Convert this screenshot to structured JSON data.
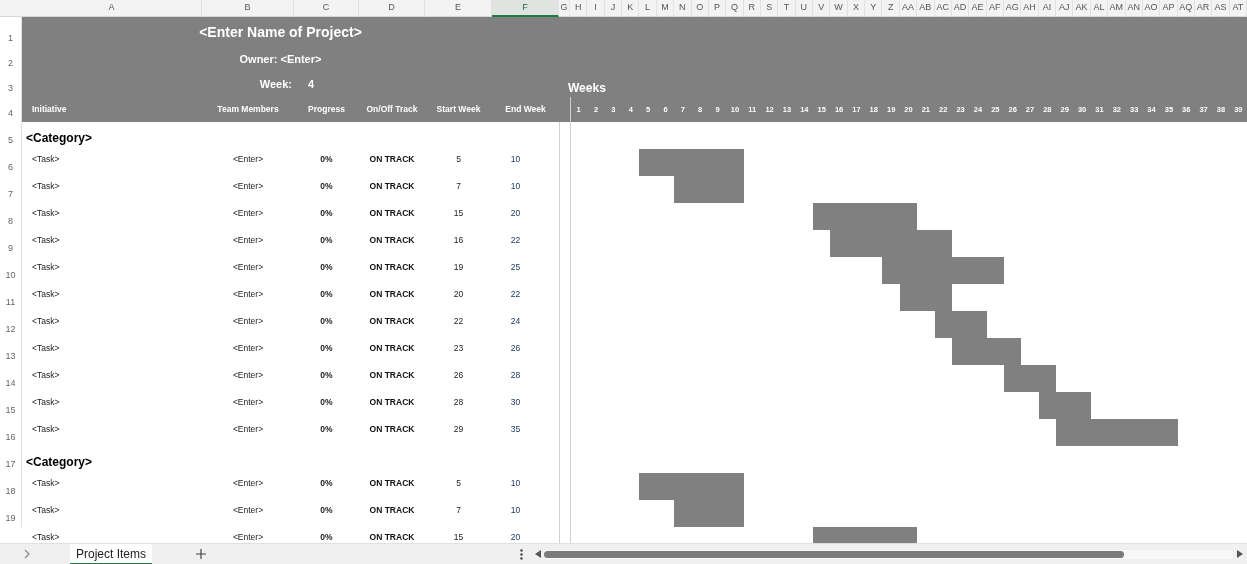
{
  "column_headers": [
    {
      "label": "A",
      "selected": false
    },
    {
      "label": "B",
      "selected": false
    },
    {
      "label": "C",
      "selected": false
    },
    {
      "label": "D",
      "selected": false
    },
    {
      "label": "E",
      "selected": false
    },
    {
      "label": "F",
      "selected": true
    },
    {
      "label": "G",
      "selected": false
    },
    {
      "label": "H",
      "selected": false
    },
    {
      "label": "I",
      "selected": false
    },
    {
      "label": "J",
      "selected": false
    },
    {
      "label": "K",
      "selected": false
    },
    {
      "label": "L",
      "selected": false
    },
    {
      "label": "M",
      "selected": false
    },
    {
      "label": "N",
      "selected": false
    },
    {
      "label": "O",
      "selected": false
    },
    {
      "label": "P",
      "selected": false
    },
    {
      "label": "Q",
      "selected": false
    },
    {
      "label": "R",
      "selected": false
    },
    {
      "label": "S",
      "selected": false
    },
    {
      "label": "T",
      "selected": false
    },
    {
      "label": "U",
      "selected": false
    },
    {
      "label": "V",
      "selected": false
    },
    {
      "label": "W",
      "selected": false
    },
    {
      "label": "X",
      "selected": false
    },
    {
      "label": "Y",
      "selected": false
    },
    {
      "label": "Z",
      "selected": false
    },
    {
      "label": "AA",
      "selected": false
    },
    {
      "label": "AB",
      "selected": false
    },
    {
      "label": "AC",
      "selected": false
    },
    {
      "label": "AD",
      "selected": false
    },
    {
      "label": "AE",
      "selected": false
    },
    {
      "label": "AF",
      "selected": false
    },
    {
      "label": "AG",
      "selected": false
    },
    {
      "label": "AH",
      "selected": false
    },
    {
      "label": "AI",
      "selected": false
    },
    {
      "label": "AJ",
      "selected": false
    },
    {
      "label": "AK",
      "selected": false
    },
    {
      "label": "AL",
      "selected": false
    },
    {
      "label": "AM",
      "selected": false
    },
    {
      "label": "AN",
      "selected": false
    },
    {
      "label": "AO",
      "selected": false
    },
    {
      "label": "AP",
      "selected": false
    },
    {
      "label": "AQ",
      "selected": false
    },
    {
      "label": "AR",
      "selected": false
    },
    {
      "label": "AS",
      "selected": false
    },
    {
      "label": "AT",
      "selected": false
    }
  ],
  "header": {
    "row_numbers": [
      "1",
      "2",
      "3",
      "4"
    ],
    "title": "<Enter Name of Project>",
    "owner": "Owner: <Enter>",
    "week_label": "Week:",
    "week_value": "4",
    "weeks_label": "Weeks",
    "columns": [
      "Initiative",
      "Team Members",
      "Progress",
      "On/Off Track",
      "Start Week",
      "End Week"
    ],
    "week_numbers": [
      "1",
      "2",
      "3",
      "4",
      "5",
      "6",
      "7",
      "8",
      "9",
      "10",
      "11",
      "12",
      "13",
      "14",
      "15",
      "16",
      "17",
      "18",
      "19",
      "20",
      "21",
      "22",
      "23",
      "24",
      "25",
      "26",
      "27",
      "28",
      "29",
      "30",
      "31",
      "32",
      "33",
      "34",
      "35",
      "36",
      "37",
      "38",
      "39"
    ]
  },
  "rows": [
    {
      "row_number": "5",
      "kind": "category",
      "label": "<Category>"
    },
    {
      "row_number": "6",
      "kind": "task",
      "initiative": "<Task>",
      "team_members": "<Enter>",
      "progress": "0%",
      "status": "ON TRACK",
      "start_week": "5",
      "end_week": "10"
    },
    {
      "row_number": "7",
      "kind": "task",
      "initiative": "<Task>",
      "team_members": "<Enter>",
      "progress": "0%",
      "status": "ON TRACK",
      "start_week": "7",
      "end_week": "10"
    },
    {
      "row_number": "8",
      "kind": "task",
      "initiative": "<Task>",
      "team_members": "<Enter>",
      "progress": "0%",
      "status": "ON TRACK",
      "start_week": "15",
      "end_week": "20"
    },
    {
      "row_number": "9",
      "kind": "task",
      "initiative": "<Task>",
      "team_members": "<Enter>",
      "progress": "0%",
      "status": "ON TRACK",
      "start_week": "16",
      "end_week": "22"
    },
    {
      "row_number": "10",
      "kind": "task",
      "initiative": "<Task>",
      "team_members": "<Enter>",
      "progress": "0%",
      "status": "ON TRACK",
      "start_week": "19",
      "end_week": "25"
    },
    {
      "row_number": "11",
      "kind": "task",
      "initiative": "<Task>",
      "team_members": "<Enter>",
      "progress": "0%",
      "status": "ON TRACK",
      "start_week": "20",
      "end_week": "22"
    },
    {
      "row_number": "12",
      "kind": "task",
      "initiative": "<Task>",
      "team_members": "<Enter>",
      "progress": "0%",
      "status": "ON TRACK",
      "start_week": "22",
      "end_week": "24"
    },
    {
      "row_number": "13",
      "kind": "task",
      "initiative": "<Task>",
      "team_members": "<Enter>",
      "progress": "0%",
      "status": "ON TRACK",
      "start_week": "23",
      "end_week": "26"
    },
    {
      "row_number": "14",
      "kind": "task",
      "initiative": "<Task>",
      "team_members": "<Enter>",
      "progress": "0%",
      "status": "ON TRACK",
      "start_week": "26",
      "end_week": "28"
    },
    {
      "row_number": "15",
      "kind": "task",
      "initiative": "<Task>",
      "team_members": "<Enter>",
      "progress": "0%",
      "status": "ON TRACK",
      "start_week": "28",
      "end_week": "30"
    },
    {
      "row_number": "16",
      "kind": "task",
      "initiative": "<Task>",
      "team_members": "<Enter>",
      "progress": "0%",
      "status": "ON TRACK",
      "start_week": "29",
      "end_week": "35"
    },
    {
      "row_number": "17",
      "kind": "category",
      "label": "<Category>"
    },
    {
      "row_number": "18",
      "kind": "task",
      "initiative": "<Task>",
      "team_members": "<Enter>",
      "progress": "0%",
      "status": "ON TRACK",
      "start_week": "5",
      "end_week": "10"
    },
    {
      "row_number": "19",
      "kind": "task",
      "initiative": "<Task>",
      "team_members": "<Enter>",
      "progress": "0%",
      "status": "ON TRACK",
      "start_week": "7",
      "end_week": "10"
    },
    {
      "kind": "task",
      "initiative": "<Task>",
      "team_members": "<Enter>",
      "progress": "0%",
      "status": "ON TRACK",
      "start_week": "15",
      "end_week": "20"
    }
  ],
  "sheet_tabs": [
    {
      "label": "Project Items",
      "selected": true
    }
  ]
}
